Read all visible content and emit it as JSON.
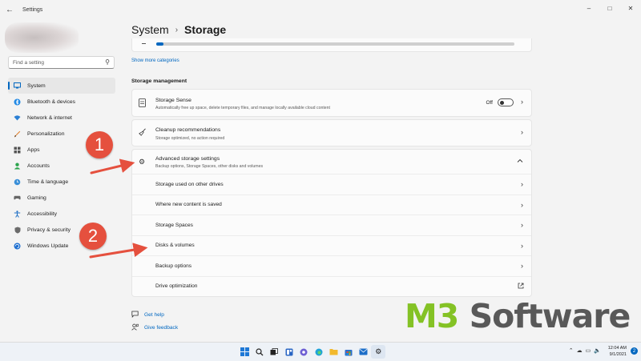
{
  "window": {
    "title": "Settings",
    "back_icon": "back-arrow-icon",
    "controls": [
      "minimize",
      "maximize",
      "close"
    ]
  },
  "search": {
    "placeholder": "Find a setting",
    "icon": "search-icon"
  },
  "sidebar": {
    "items": [
      {
        "label": "System",
        "icon": "system-icon",
        "active": true
      },
      {
        "label": "Bluetooth & devices",
        "icon": "bluetooth-icon"
      },
      {
        "label": "Network & internet",
        "icon": "wifi-icon"
      },
      {
        "label": "Personalization",
        "icon": "brush-icon"
      },
      {
        "label": "Apps",
        "icon": "apps-icon"
      },
      {
        "label": "Accounts",
        "icon": "person-icon"
      },
      {
        "label": "Time & language",
        "icon": "globe-clock-icon"
      },
      {
        "label": "Gaming",
        "icon": "gamepad-icon"
      },
      {
        "label": "Accessibility",
        "icon": "accessibility-icon"
      },
      {
        "label": "Privacy & security",
        "icon": "shield-icon"
      },
      {
        "label": "Windows Update",
        "icon": "update-icon"
      }
    ]
  },
  "breadcrumb": {
    "parent": "System",
    "separator": "›",
    "current": "Storage"
  },
  "storage_bar": {
    "used_fraction": 0.02
  },
  "show_more": "Show more categories",
  "storage_management": {
    "title": "Storage management",
    "storage_sense": {
      "title": "Storage Sense",
      "desc": "Automatically free up space, delete temporary files, and manage locally available cloud content",
      "toggle_label": "Off",
      "toggle_on": false
    },
    "cleanup": {
      "title": "Cleanup recommendations",
      "desc": "Storage optimized, no action required"
    },
    "advanced": {
      "title": "Advanced storage settings",
      "desc": "Backup options, Storage Spaces, other disks and volumes",
      "expanded": true,
      "items": [
        "Storage used on other drives",
        "Where new content is saved",
        "Storage Spaces",
        "Disks & volumes",
        "Backup options",
        "Drive optimization"
      ]
    }
  },
  "help_links": {
    "get_help": "Get help",
    "give_feedback": "Give feedback"
  },
  "annotations": {
    "badge1": "1",
    "badge2": "2",
    "color": "#e5503e"
  },
  "watermark": {
    "part1": "M3",
    "part2": " Software",
    "color1": "#84c225",
    "color2": "#595959"
  },
  "taskbar": {
    "time": "12:04 AM",
    "date": "9/1/2021",
    "notifications": "2"
  }
}
